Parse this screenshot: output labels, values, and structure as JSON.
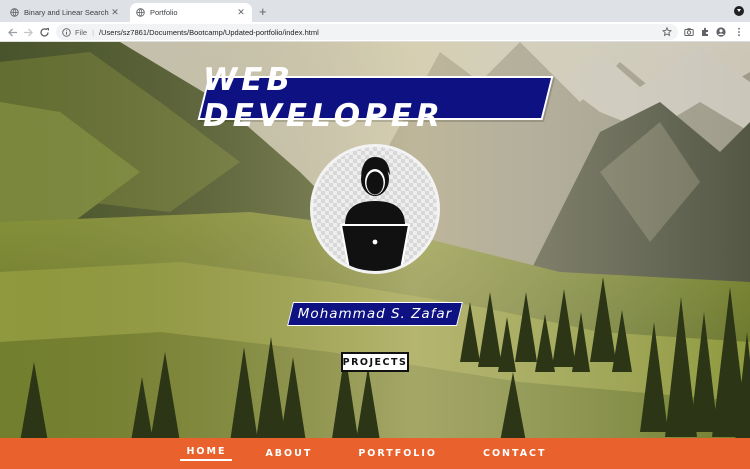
{
  "browser": {
    "tabs": [
      {
        "title": "Binary and Linear Search Visu",
        "active": false
      },
      {
        "title": "Portfolio",
        "active": true
      }
    ],
    "new_tab_label": "+",
    "address": {
      "scheme": "File",
      "url": "/Users/sz7861/Documents/Bootcamp/Updated-portfolio/index.html"
    }
  },
  "hero": {
    "title": "WEB DEVELOPER",
    "name": "Mohammad S. Zafar",
    "projects_label": "PROJECTS",
    "avatar_icon": "developer-laptop-icon"
  },
  "nav": {
    "items": [
      "HOME",
      "ABOUT",
      "PORTFOLIO",
      "CONTACT"
    ],
    "active": "HOME"
  },
  "colors": {
    "banner": "#0d1181",
    "nav_bar": "#e9622d",
    "text_light": "#ffffff"
  }
}
